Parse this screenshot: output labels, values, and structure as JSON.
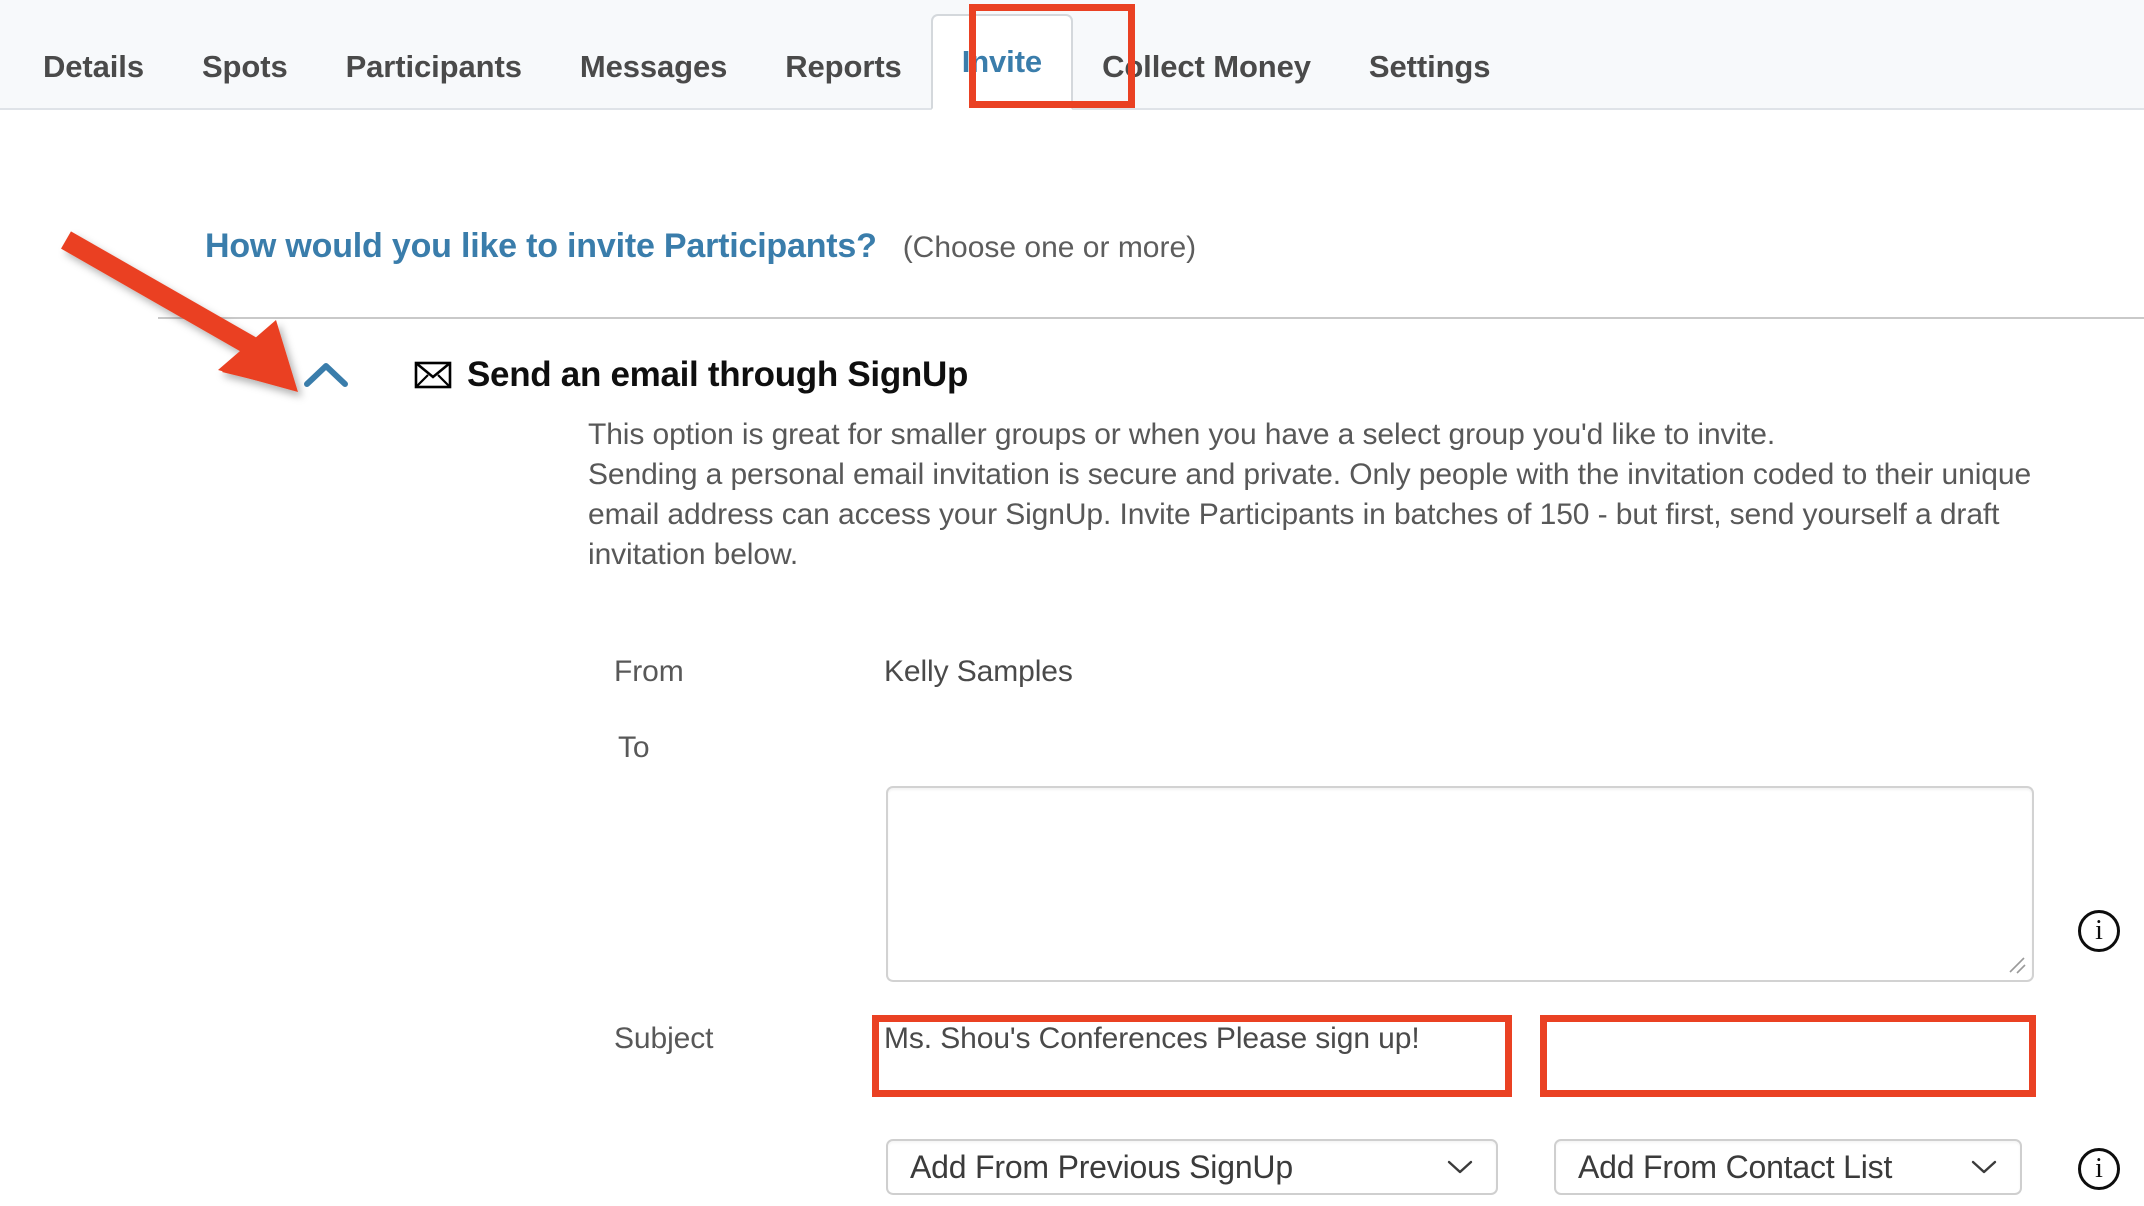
{
  "tabs": [
    {
      "label": "Details",
      "active": false
    },
    {
      "label": "Spots",
      "active": false
    },
    {
      "label": "Participants",
      "active": false
    },
    {
      "label": "Messages",
      "active": false
    },
    {
      "label": "Reports",
      "active": false
    },
    {
      "label": "Invite",
      "active": true
    },
    {
      "label": "Collect Money",
      "active": false
    },
    {
      "label": "Settings",
      "active": false
    }
  ],
  "heading": {
    "question": "How would you like to invite Participants?",
    "hint": "(Choose one or more)"
  },
  "section": {
    "title": "Send an email through SignUp",
    "envelope_icon": "envelope-icon",
    "collapse_icon": "chevron-up-icon",
    "description_line_1": "This option is great for smaller groups or when you have a select group you'd like to invite.",
    "description_line_2": "Sending a personal email invitation is secure and private. Only people with the invitation coded to their unique",
    "description_line_3": "email address can access your SignUp. Invite Participants in batches of 150 - but first, send yourself a draft",
    "description_line_4": "invitation below."
  },
  "form": {
    "from_label": "From",
    "from_value": "Kelly Samples",
    "to_label": "To",
    "to_value": "",
    "to_placeholder": "",
    "subject_label": "Subject",
    "subject_value": "Ms. Shou's Conferences Please sign up!",
    "dropdown_previous_signup": "Add From Previous SignUp",
    "dropdown_contact_list": "Add From Contact List",
    "info_icon_to": "info-icon",
    "info_icon_dropdown": "info-icon"
  },
  "colors": {
    "accent_blue": "#3a7dab",
    "annotation_red": "#ea4123",
    "tabbar_bg": "#f7f9fb",
    "body_text": "#585858"
  }
}
